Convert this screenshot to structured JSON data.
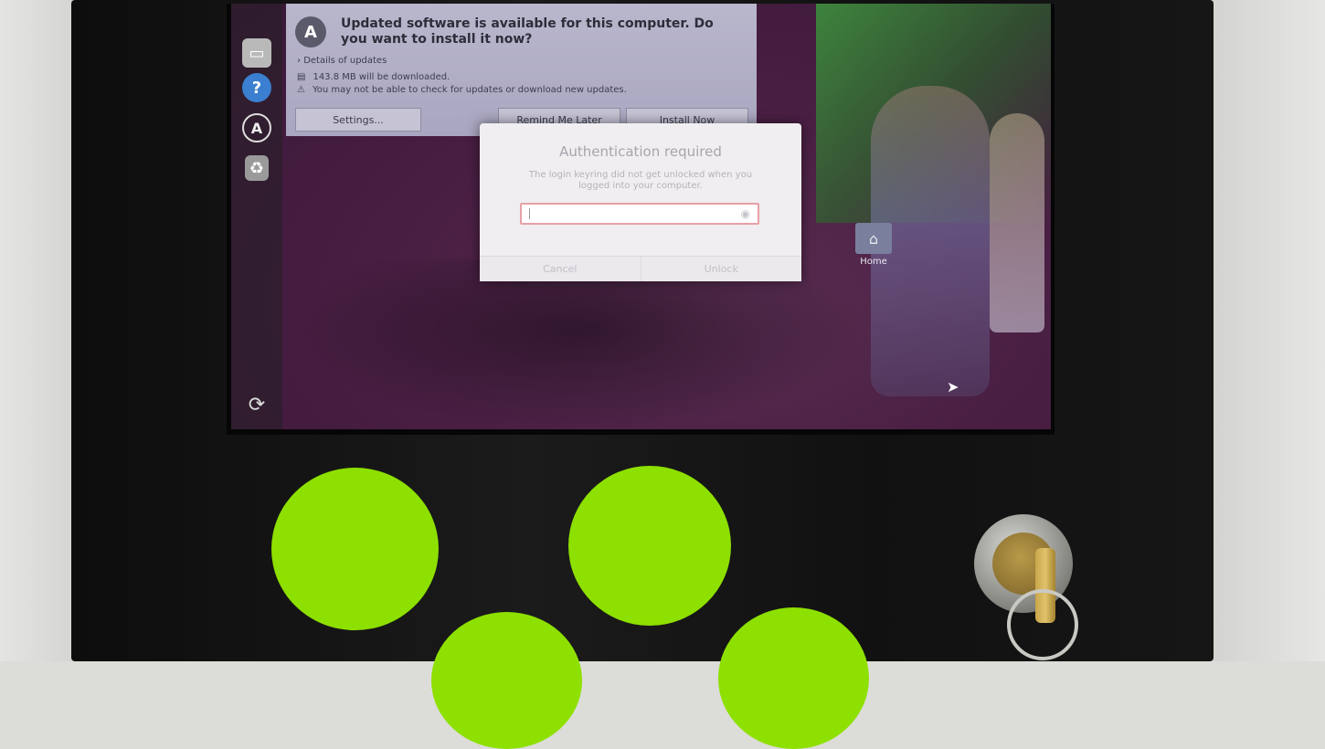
{
  "update_dialog": {
    "title": "Updated software is available for this computer. Do you want to install it now?",
    "details_label": "Details of updates",
    "download_size": "143.8 MB will be downloaded.",
    "warning": "You may not be able to check for updates or download new updates.",
    "settings_label": "Settings...",
    "remind_label": "Remind Me Later",
    "install_label": "Install Now"
  },
  "auth_dialog": {
    "title": "Authentication required",
    "message": "The login keyring did not get unlocked when you logged into your computer.",
    "password_value": "",
    "cancel_label": "Cancel",
    "unlock_label": "Unlock"
  },
  "desktop": {
    "home_label": "Home"
  },
  "colors": {
    "kiosk_button": "#8ee000",
    "panel": "#111111",
    "desktop_bg": "#4a1f44"
  }
}
